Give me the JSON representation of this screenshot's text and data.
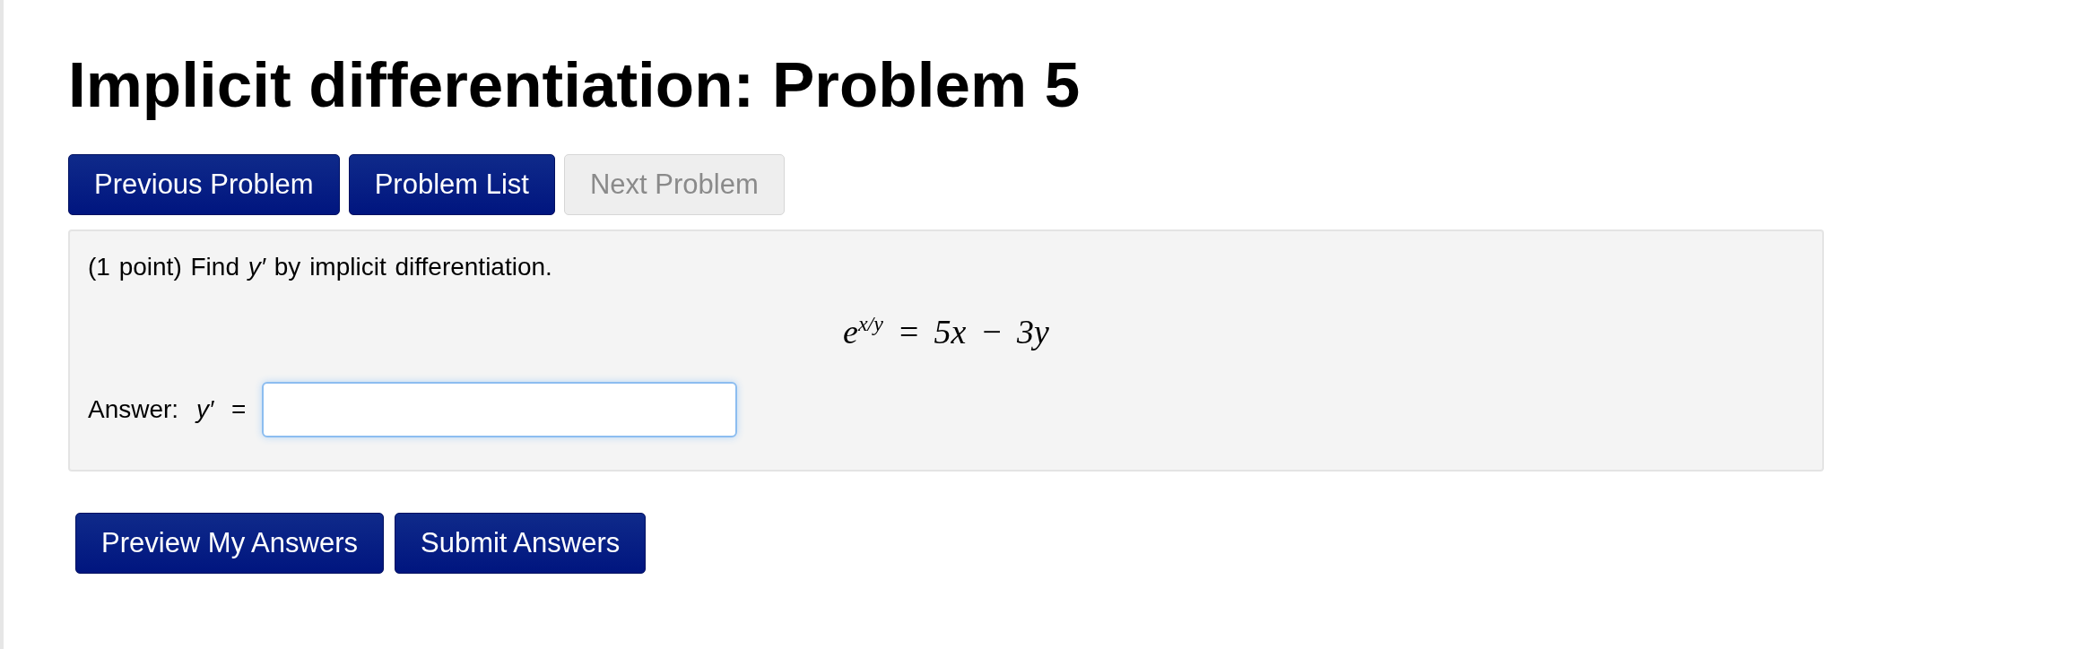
{
  "title": "Implicit differentiation: Problem 5",
  "nav_buttons": [
    {
      "label": "Previous Problem",
      "disabled": false
    },
    {
      "label": "Problem List",
      "disabled": false
    },
    {
      "label": "Next Problem",
      "disabled": true
    }
  ],
  "problem": {
    "statement": "(1 point) Find *y′* by implicit differentiation.",
    "equation": "e$^{x/y}$ = 5x − 3y",
    "answer_label": "Answer: *y′* ="
  },
  "submit_buttons": [
    {
      "label": "Preview My Answers"
    },
    {
      "label": "Submit Answers"
    }
  ]
}
